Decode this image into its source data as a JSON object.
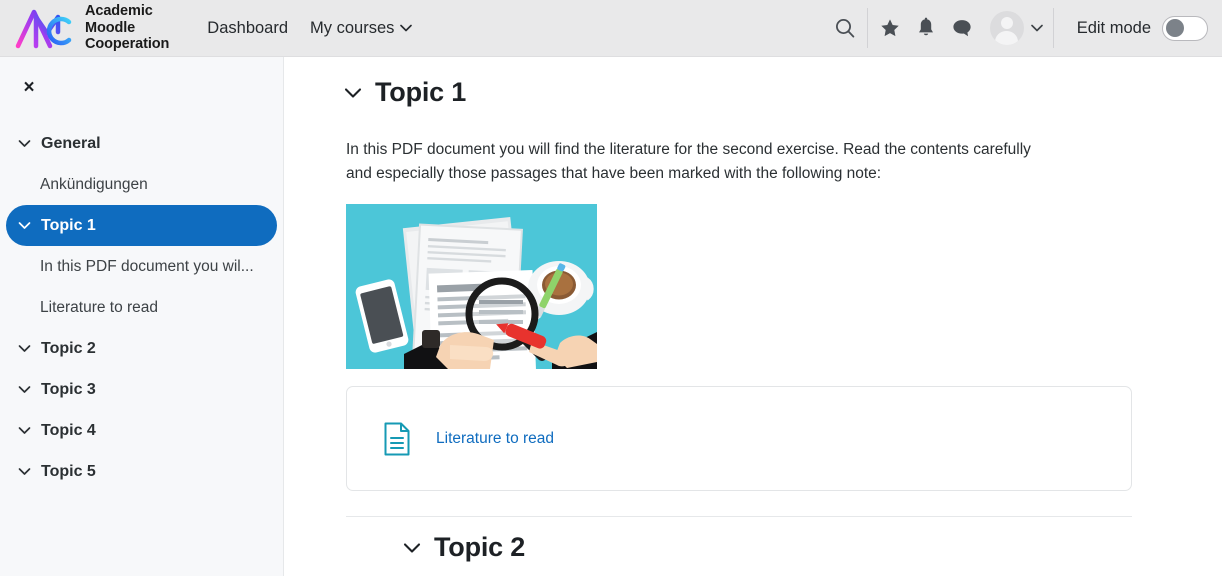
{
  "header": {
    "brand": {
      "line1": "Academic",
      "line2": "Moodle",
      "line3": "Cooperation",
      "logo_icon": "amc-logo-icon",
      "colors": {
        "magenta": "#e040d0",
        "purple": "#7a3cf0",
        "blue": "#2b5cf5",
        "cyan": "#33c6f4"
      }
    },
    "nav": [
      {
        "label": "Dashboard",
        "has_chevron": false
      },
      {
        "label": "My courses",
        "has_chevron": true
      }
    ],
    "icons": [
      {
        "name": "search-icon"
      },
      {
        "name": "star-icon"
      },
      {
        "name": "bell-icon"
      },
      {
        "name": "message-icon"
      }
    ],
    "avatar": {
      "name": "avatar",
      "chevron": "chevron-down-icon"
    },
    "edit_mode": {
      "label": "Edit mode",
      "state": "off"
    }
  },
  "sidebar": {
    "close_label": "×",
    "items": [
      {
        "label": "General",
        "type": "section",
        "expanded": true,
        "active": false
      },
      {
        "label": "Ankündigungen",
        "type": "activity",
        "active": false
      },
      {
        "label": "Topic 1",
        "type": "section",
        "expanded": true,
        "active": true
      },
      {
        "label": "In this PDF document you wil...",
        "type": "activity",
        "active": false
      },
      {
        "label": "Literature to read",
        "type": "activity",
        "active": false
      },
      {
        "label": "Topic 2",
        "type": "section",
        "expanded": true,
        "active": false
      },
      {
        "label": "Topic 3",
        "type": "section",
        "expanded": true,
        "active": false
      },
      {
        "label": "Topic 4",
        "type": "section",
        "expanded": true,
        "active": false
      },
      {
        "label": "Topic 5",
        "type": "section",
        "expanded": true,
        "active": false
      }
    ],
    "active_color": "#0f6cbf"
  },
  "main": {
    "topic1": {
      "title": "Topic 1",
      "paragraph": "In this PDF document you will find the literature for the second exercise. Read the contents carefully and especially those passages that have been marked with the following note:",
      "illustration": {
        "name": "document-review-illustration",
        "background": "#4cc6d8",
        "elements": [
          "papers",
          "magnifying-glass",
          "hands",
          "smartphone",
          "coffee-cup",
          "green-pen",
          "red-marker",
          "suit-sleeves"
        ]
      },
      "activity": {
        "icon": "resource-document-icon",
        "icon_color": "#169ab4",
        "label": "Literature to read",
        "link_color": "#0f6cbf"
      }
    },
    "topic2": {
      "title": "Topic 2"
    }
  }
}
